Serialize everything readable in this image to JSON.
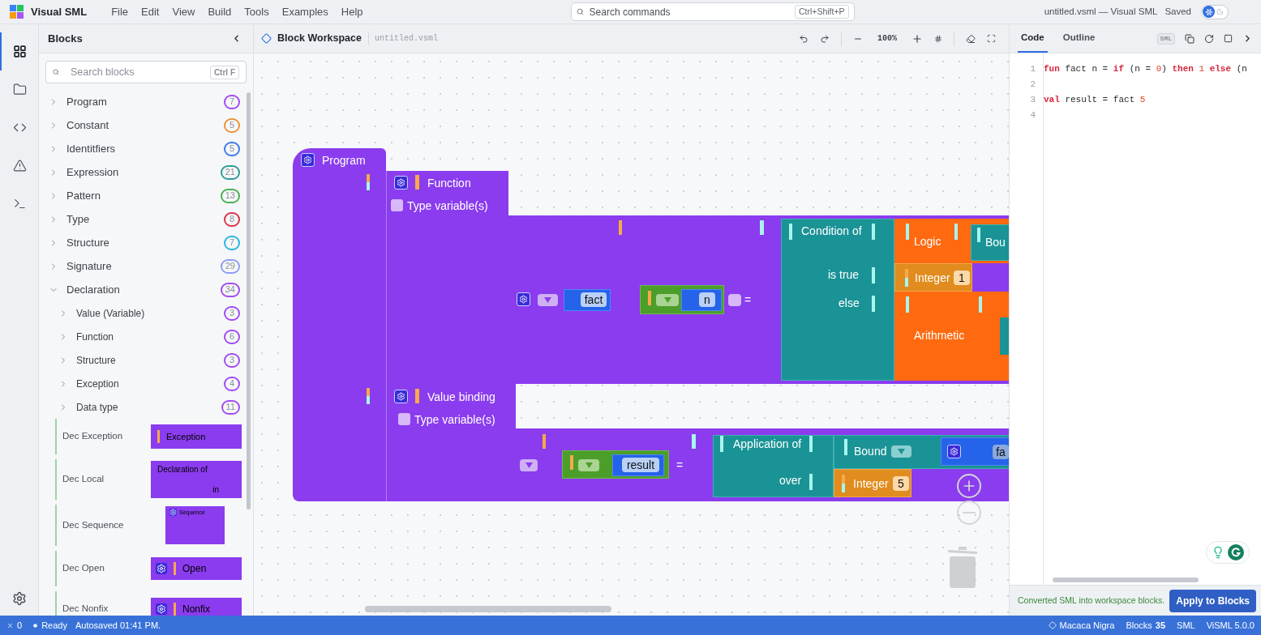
{
  "app": {
    "name": "Visual SML",
    "menu": [
      "File",
      "Edit",
      "View",
      "Build",
      "Tools",
      "Examples",
      "Help"
    ]
  },
  "command_search": {
    "placeholder": "Search commands",
    "shortcut": "Ctrl+Shift+P"
  },
  "window_title": "untitled.vsml — Visual SML",
  "save_status": "Saved",
  "theme_toggle": {
    "dark": false
  },
  "activity_bar": [
    {
      "kind": "blocks",
      "selected": true
    },
    {
      "kind": "files",
      "selected": false
    },
    {
      "kind": "code",
      "selected": false
    },
    {
      "kind": "problems",
      "selected": false
    },
    {
      "kind": "terminal",
      "selected": false
    }
  ],
  "sidebar": {
    "title": "Blocks",
    "search": {
      "placeholder": "Search blocks",
      "shortcut": "Ctrl F"
    },
    "categories": [
      {
        "label": "Program",
        "count": "7",
        "color": "#a24cf0",
        "expanded": false
      },
      {
        "label": "Constant",
        "count": "5",
        "color": "#e8963a",
        "expanded": false
      },
      {
        "label": "Identitfiers",
        "count": "5",
        "color": "#3b7bea",
        "expanded": false
      },
      {
        "label": "Expression",
        "count": "21",
        "color": "#2a9d98",
        "expanded": false
      },
      {
        "label": "Pattern",
        "count": "13",
        "color": "#4caf50",
        "expanded": false
      },
      {
        "label": "Type",
        "count": "8",
        "color": "#d8344a",
        "expanded": false
      },
      {
        "label": "Structure",
        "count": "7",
        "color": "#29b6e0",
        "expanded": false
      },
      {
        "label": "Signature",
        "count": "29",
        "color": "#8e9cf5",
        "expanded": false
      },
      {
        "label": "Declaration",
        "count": "34",
        "color": "#a24cf0",
        "expanded": true,
        "children": [
          {
            "label": "Value (Variable)",
            "count": "3",
            "color": "#a24cf0",
            "expanded": false
          },
          {
            "label": "Function",
            "count": "6",
            "color": "#a24cf0",
            "expanded": false
          },
          {
            "label": "Structure",
            "count": "3",
            "color": "#a24cf0",
            "expanded": false
          },
          {
            "label": "Exception",
            "count": "4",
            "color": "#a24cf0",
            "expanded": false
          },
          {
            "label": "Data type",
            "count": "11",
            "color": "#a24cf0",
            "expanded": false
          }
        ],
        "blocks": [
          {
            "label": "Dec Exception",
            "kind": "single",
            "texts": [
              "Exception"
            ]
          },
          {
            "label": "Dec Local",
            "kind": "double",
            "texts": [
              "Declaration of",
              "in"
            ]
          },
          {
            "label": "Dec Sequence",
            "kind": "sequence",
            "texts": [
              "Sequence"
            ]
          },
          {
            "label": "Dec Open",
            "kind": "gear",
            "texts": [
              "Open"
            ]
          },
          {
            "label": "Dec Nonfix",
            "kind": "gear",
            "texts": [
              "Nonfix"
            ]
          }
        ]
      }
    ]
  },
  "workspace": {
    "title": "Block Workspace",
    "file": "untitled.vsml",
    "zoom": "100%",
    "program": "Program",
    "function": {
      "label": "Function",
      "type_variables": "Type variable(s)",
      "type_variables_checked": false,
      "name": "fact",
      "parameter": "n",
      "equals": "="
    },
    "condition": {
      "label": "Condition of",
      "then_label": "is true",
      "else_label": "else",
      "test": "Logic",
      "test_operand": "Bou",
      "then_value": {
        "label": "Integer",
        "value": "1"
      },
      "else_value": "Arithmetic"
    },
    "value_binding": {
      "label": "Value binding",
      "type_variables": "Type variable(s)",
      "type_variables_checked": false,
      "pattern": "result",
      "equals": "="
    },
    "application": {
      "label": "Application of",
      "argument_label": "over",
      "function": "Bound",
      "function_name": "fa",
      "argument": {
        "label": "Integer",
        "value": "5"
      }
    }
  },
  "code_panel": {
    "tabs": [
      {
        "label": "Code",
        "selected": true
      },
      {
        "label": "Outline",
        "selected": false
      }
    ],
    "language": "SML",
    "lines": [
      {
        "number": "1",
        "tokens": [
          {
            "kind": "keyword",
            "text": "fun"
          },
          {
            "kind": "plain",
            "text": " fact n = "
          },
          {
            "kind": "keyword",
            "text": "if"
          },
          {
            "kind": "plain",
            "text": " (n = "
          },
          {
            "kind": "number",
            "text": "0"
          },
          {
            "kind": "plain",
            "text": ") "
          },
          {
            "kind": "keyword",
            "text": "then "
          },
          {
            "kind": "number",
            "text": "1 "
          },
          {
            "kind": "keyword",
            "text": "else"
          },
          {
            "kind": "plain",
            "text": " (n"
          }
        ]
      },
      {
        "number": "2"
      },
      {
        "number": "3",
        "tokens": [
          {
            "kind": "keyword",
            "text": "val"
          },
          {
            "kind": "plain",
            "text": " result = fact "
          },
          {
            "kind": "number",
            "text": "5"
          }
        ]
      },
      {
        "number": "4"
      }
    ],
    "message": "Converted SML into workspace blocks.",
    "apply_button": "Apply to Blocks"
  },
  "status_bar": {
    "errors": "0",
    "state": "Ready",
    "autosave": "Autosaved 01:41 PM.",
    "user": "Macaca Nigra",
    "blocks_label": "Blocks",
    "blocks_count": "35",
    "language": "SML",
    "version": "ViSML 5.0.0"
  }
}
